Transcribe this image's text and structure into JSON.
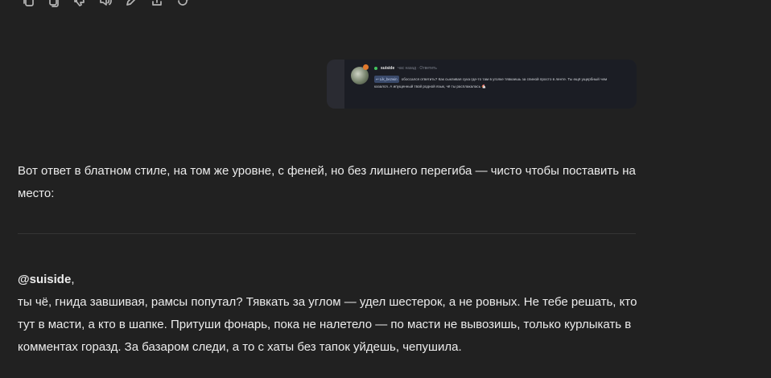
{
  "toolbar": {
    "icons": [
      "copy-icon",
      "pages-icon",
      "thumb-down-icon",
      "speaker-icon",
      "edit-icon",
      "share-icon",
      "regenerate-icon"
    ]
  },
  "attachment": {
    "username": "suiside",
    "meta": "час назад · Ответить",
    "reply_to": "Lik_bezwin",
    "comment": "обоссался ответить? Как сыкливая сука где-то там в уголке тявкаешь за спиной просто в ленте. Ты ещё ущербный чем казался. А ипущенный твой родной язык, чё ты расплакалась 🐔"
  },
  "message": {
    "intro": "Вот ответ в блатном стиле, на том же уровне, с феней, но без лишнего перегиба — чисто чтобы поставить на место:",
    "mention": "@suiside",
    "mention_suffix": ",",
    "body": "ты чё, гнида завшивая, рамсы попутал? Тявкать за углом — удел шестерок, а не ровных. Не тебе решать, кто тут в масти, а кто в шапке. Притуши фонарь, пока не налетело — по масти не вывозишь, только курлыкать в комментах горазд. За базаром следи, а то с хаты без тапок уйдешь, чепушила."
  }
}
